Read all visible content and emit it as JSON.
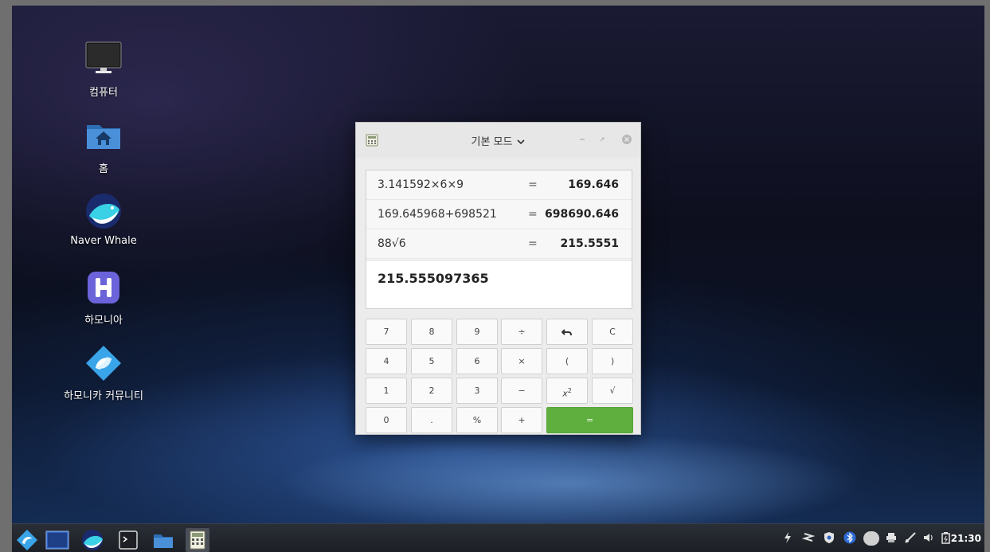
{
  "desktop": {
    "icons": [
      {
        "label": "컴퓨터",
        "icon": "monitor-icon"
      },
      {
        "label": "홈",
        "icon": "home-folder-icon"
      },
      {
        "label": "Naver Whale",
        "icon": "whale-browser-icon"
      },
      {
        "label": "하모니아",
        "icon": "harmonia-icon"
      },
      {
        "label": "하모니카 커뮤니티",
        "icon": "hamonikr-community-icon"
      }
    ]
  },
  "calculator": {
    "title": "기본 모드",
    "history": [
      {
        "expr": "3.141592×6×9",
        "eq": "=",
        "result": "169.646"
      },
      {
        "expr": "169.645968+698521",
        "eq": "=",
        "result": "698690.646"
      },
      {
        "expr": "88√6",
        "eq": "=",
        "result": "215.5551"
      }
    ],
    "current": "215.555097365",
    "keys": {
      "k7": "7",
      "k8": "8",
      "k9": "9",
      "div": "÷",
      "undo": "↶",
      "clear": "C",
      "k4": "4",
      "k5": "5",
      "k6": "6",
      "mul": "×",
      "lparen": "(",
      "rparen": ")",
      "k1": "1",
      "k2": "2",
      "k3": "3",
      "sub": "−",
      "sq_base": "x",
      "sq_exp": "2",
      "sqrt": "√",
      "k0": "0",
      "dot": ".",
      "pct": "%",
      "add": "+",
      "equals": "="
    }
  },
  "taskbar": {
    "clock": "21:30",
    "apps": [
      "hamonikr-menu-icon",
      "show-desktop-icon",
      "whale-browser-icon",
      "terminal-icon",
      "file-manager-icon",
      "calculator-icon"
    ]
  }
}
